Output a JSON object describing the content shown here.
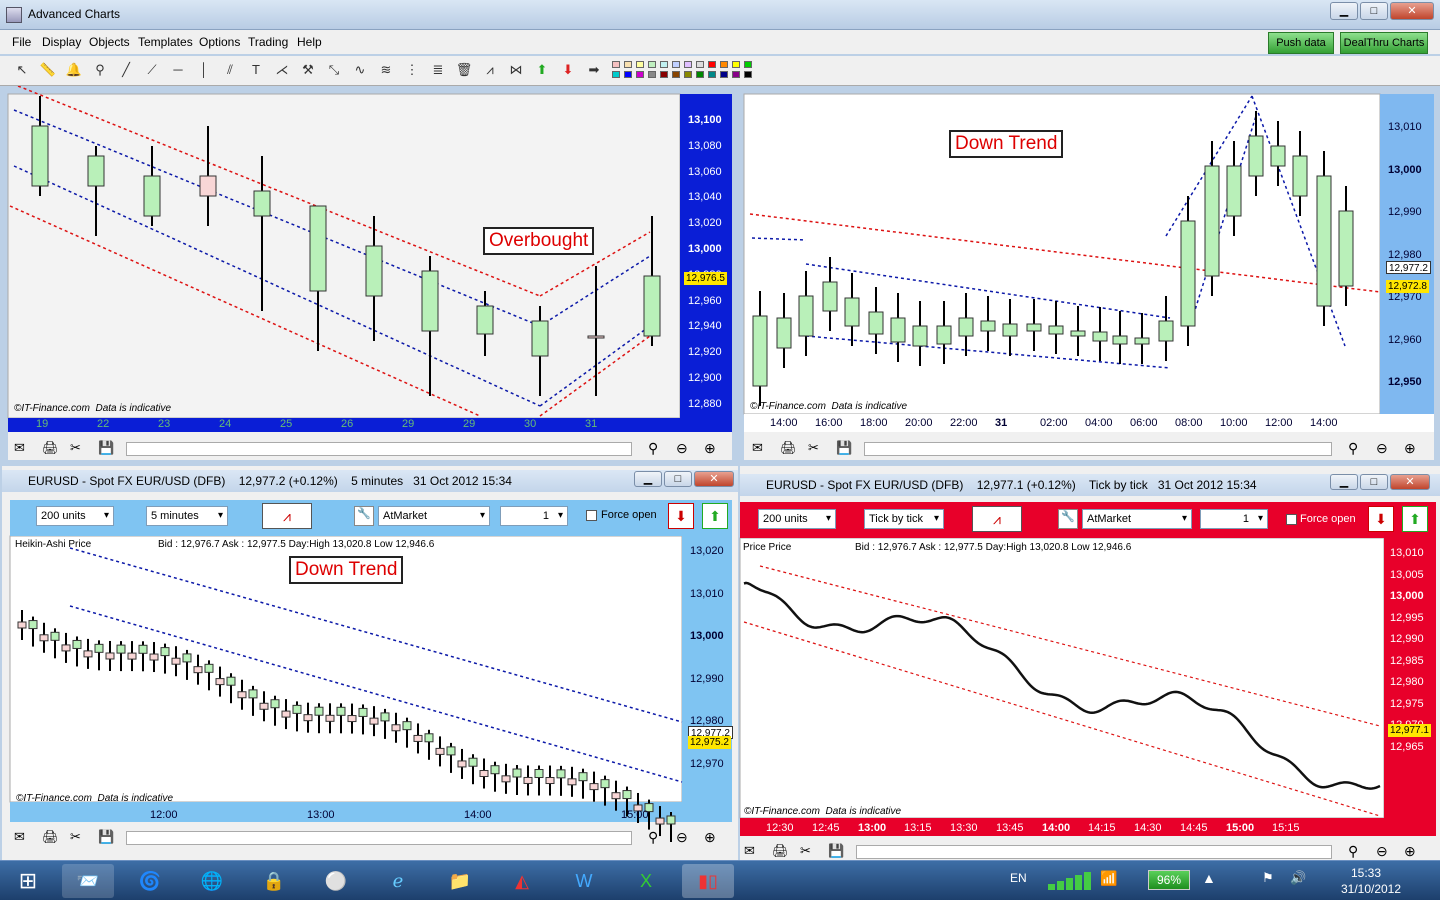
{
  "window": {
    "title": "Advanced Charts"
  },
  "menu": [
    "File",
    "Display",
    "Objects",
    "Templates",
    "Options",
    "Trading",
    "Help"
  ],
  "buttons": {
    "push": "Push data",
    "dealthru": "DealThru Charts"
  },
  "colors": {
    "bull": "#b9f0b9",
    "bear": "#f8d6d6",
    "red_channel": "#d11",
    "blue_channel": "#0b18a8",
    "axis_blue": "#0a1ed6",
    "axis_red": "#e8002a",
    "axis_light": "#7fc4f2"
  },
  "panel_tl": {
    "annotation": "Overbought",
    "yticks": [
      "13,100",
      "13,080",
      "13,060",
      "13,040",
      "13,020",
      "13,000",
      "12,980",
      "12,960",
      "12,940",
      "12,920",
      "12,900",
      "12,880"
    ],
    "last_price": "12,976.5",
    "xticks": [
      "19",
      "22",
      "23",
      "24",
      "25",
      "26",
      "29",
      "29",
      "30",
      "31"
    ],
    "footer_left": "©IT-Finance.com",
    "footer_right": "Data is indicative"
  },
  "panel_tr": {
    "annotation": "Down Trend",
    "yticks": [
      "13,010",
      "13,000",
      "12,990",
      "12,980",
      "12,970",
      "12,960",
      "12,950"
    ],
    "price_tags": [
      "12,977.2",
      "12,972.8"
    ],
    "xticks": [
      "14:00",
      "16:00",
      "18:00",
      "20:00",
      "22:00",
      "31",
      "02:00",
      "04:00",
      "06:00",
      "08:00",
      "10:00",
      "12:00",
      "14:00"
    ],
    "footer_left": "©IT-Finance.com",
    "footer_right": "Data is indicative"
  },
  "panel_bl": {
    "title": "EURUSD - Spot FX EUR/USD (DFB)",
    "price": "12,977.2 (+0.12%)",
    "interval": "5 minutes",
    "datetime": "31 Oct 2012 15:34",
    "units": "200 units",
    "period": "5 minutes",
    "order": "AtMarket",
    "qty": "1",
    "force": "Force open",
    "series_label": "Heikin-Ashi Price",
    "info": "Bid : 12,976.7  Ask : 12,977.5  Day:High 13,020.8  Low 12,946.6",
    "annotation": "Down Trend",
    "yticks": [
      "13,020",
      "13,010",
      "13,000",
      "12,990",
      "12,980",
      "12,970"
    ],
    "price_tags": [
      "12,977.2",
      "12,975.2"
    ],
    "xticks": [
      "12:00",
      "13:00",
      "14:00",
      "15:00"
    ],
    "footer_left": "©IT-Finance.com",
    "footer_right": "Data is indicative"
  },
  "panel_br": {
    "title": "EURUSD - Spot FX EUR/USD (DFB)",
    "price": "12,977.1 (+0.12%)",
    "interval": "Tick by tick",
    "datetime": "31 Oct 2012 15:34",
    "units": "200 units",
    "period": "Tick by tick",
    "order": "AtMarket",
    "qty": "1",
    "force": "Force open",
    "series_label": "Price Price",
    "info": "Bid : 12,976.7  Ask : 12,977.5  Day:High 13,020.8  Low 12,946.6",
    "yticks": [
      "13,010",
      "13,005",
      "13,000",
      "12,995",
      "12,990",
      "12,985",
      "12,980",
      "12,975",
      "12,970",
      "12,965"
    ],
    "price_tag": "12,977.1",
    "xticks": [
      "12:30",
      "12:45",
      "13:00",
      "13:15",
      "13:30",
      "13:45",
      "14:00",
      "14:15",
      "14:30",
      "14:45",
      "15:00",
      "15:15"
    ],
    "footer_left": "©IT-Finance.com",
    "footer_right": "Data is indicative"
  },
  "taskbar": {
    "lang": "EN",
    "battery": "96%",
    "time": "15:33",
    "date": "31/10/2012"
  }
}
